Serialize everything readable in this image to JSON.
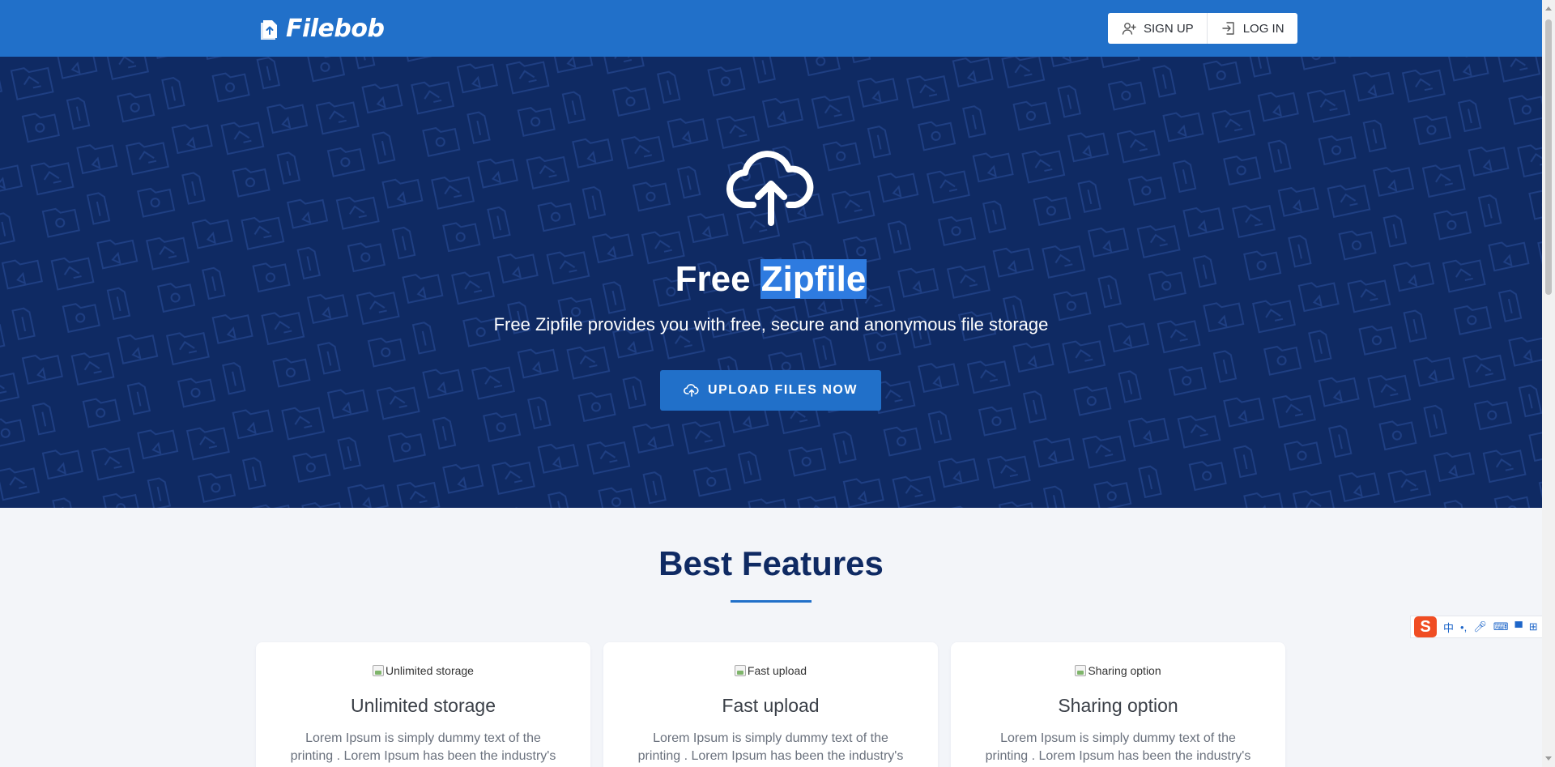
{
  "header": {
    "logo_text": "Filebob",
    "signup_label": "SIGN UP",
    "login_label": "LOG IN"
  },
  "hero": {
    "title_prefix": "Free ",
    "title_highlight": "Zipfile",
    "subtitle": "Free Zipfile provides you with free, secure and anonymous file storage",
    "upload_label": "UPLOAD FILES NOW"
  },
  "features": {
    "title": "Best Features",
    "cards": [
      {
        "alt": "Unlimited storage",
        "title": "Unlimited storage",
        "text": "Lorem Ipsum is simply dummy text of the printing . Lorem Ipsum has been the industry's"
      },
      {
        "alt": "Fast upload",
        "title": "Fast upload",
        "text": "Lorem Ipsum is simply dummy text of the printing . Lorem Ipsum has been the industry's"
      },
      {
        "alt": "Sharing option",
        "title": "Sharing option",
        "text": "Lorem Ipsum is simply dummy text of the printing . Lorem Ipsum has been the industry's"
      }
    ]
  },
  "ime_toolbar": {
    "logo": "S",
    "mode": "中"
  },
  "colors": {
    "topbar": "#2170c9",
    "hero_bg": "#0f2a63",
    "highlight": "#2e7be0",
    "features_title": "#0f2a63"
  }
}
